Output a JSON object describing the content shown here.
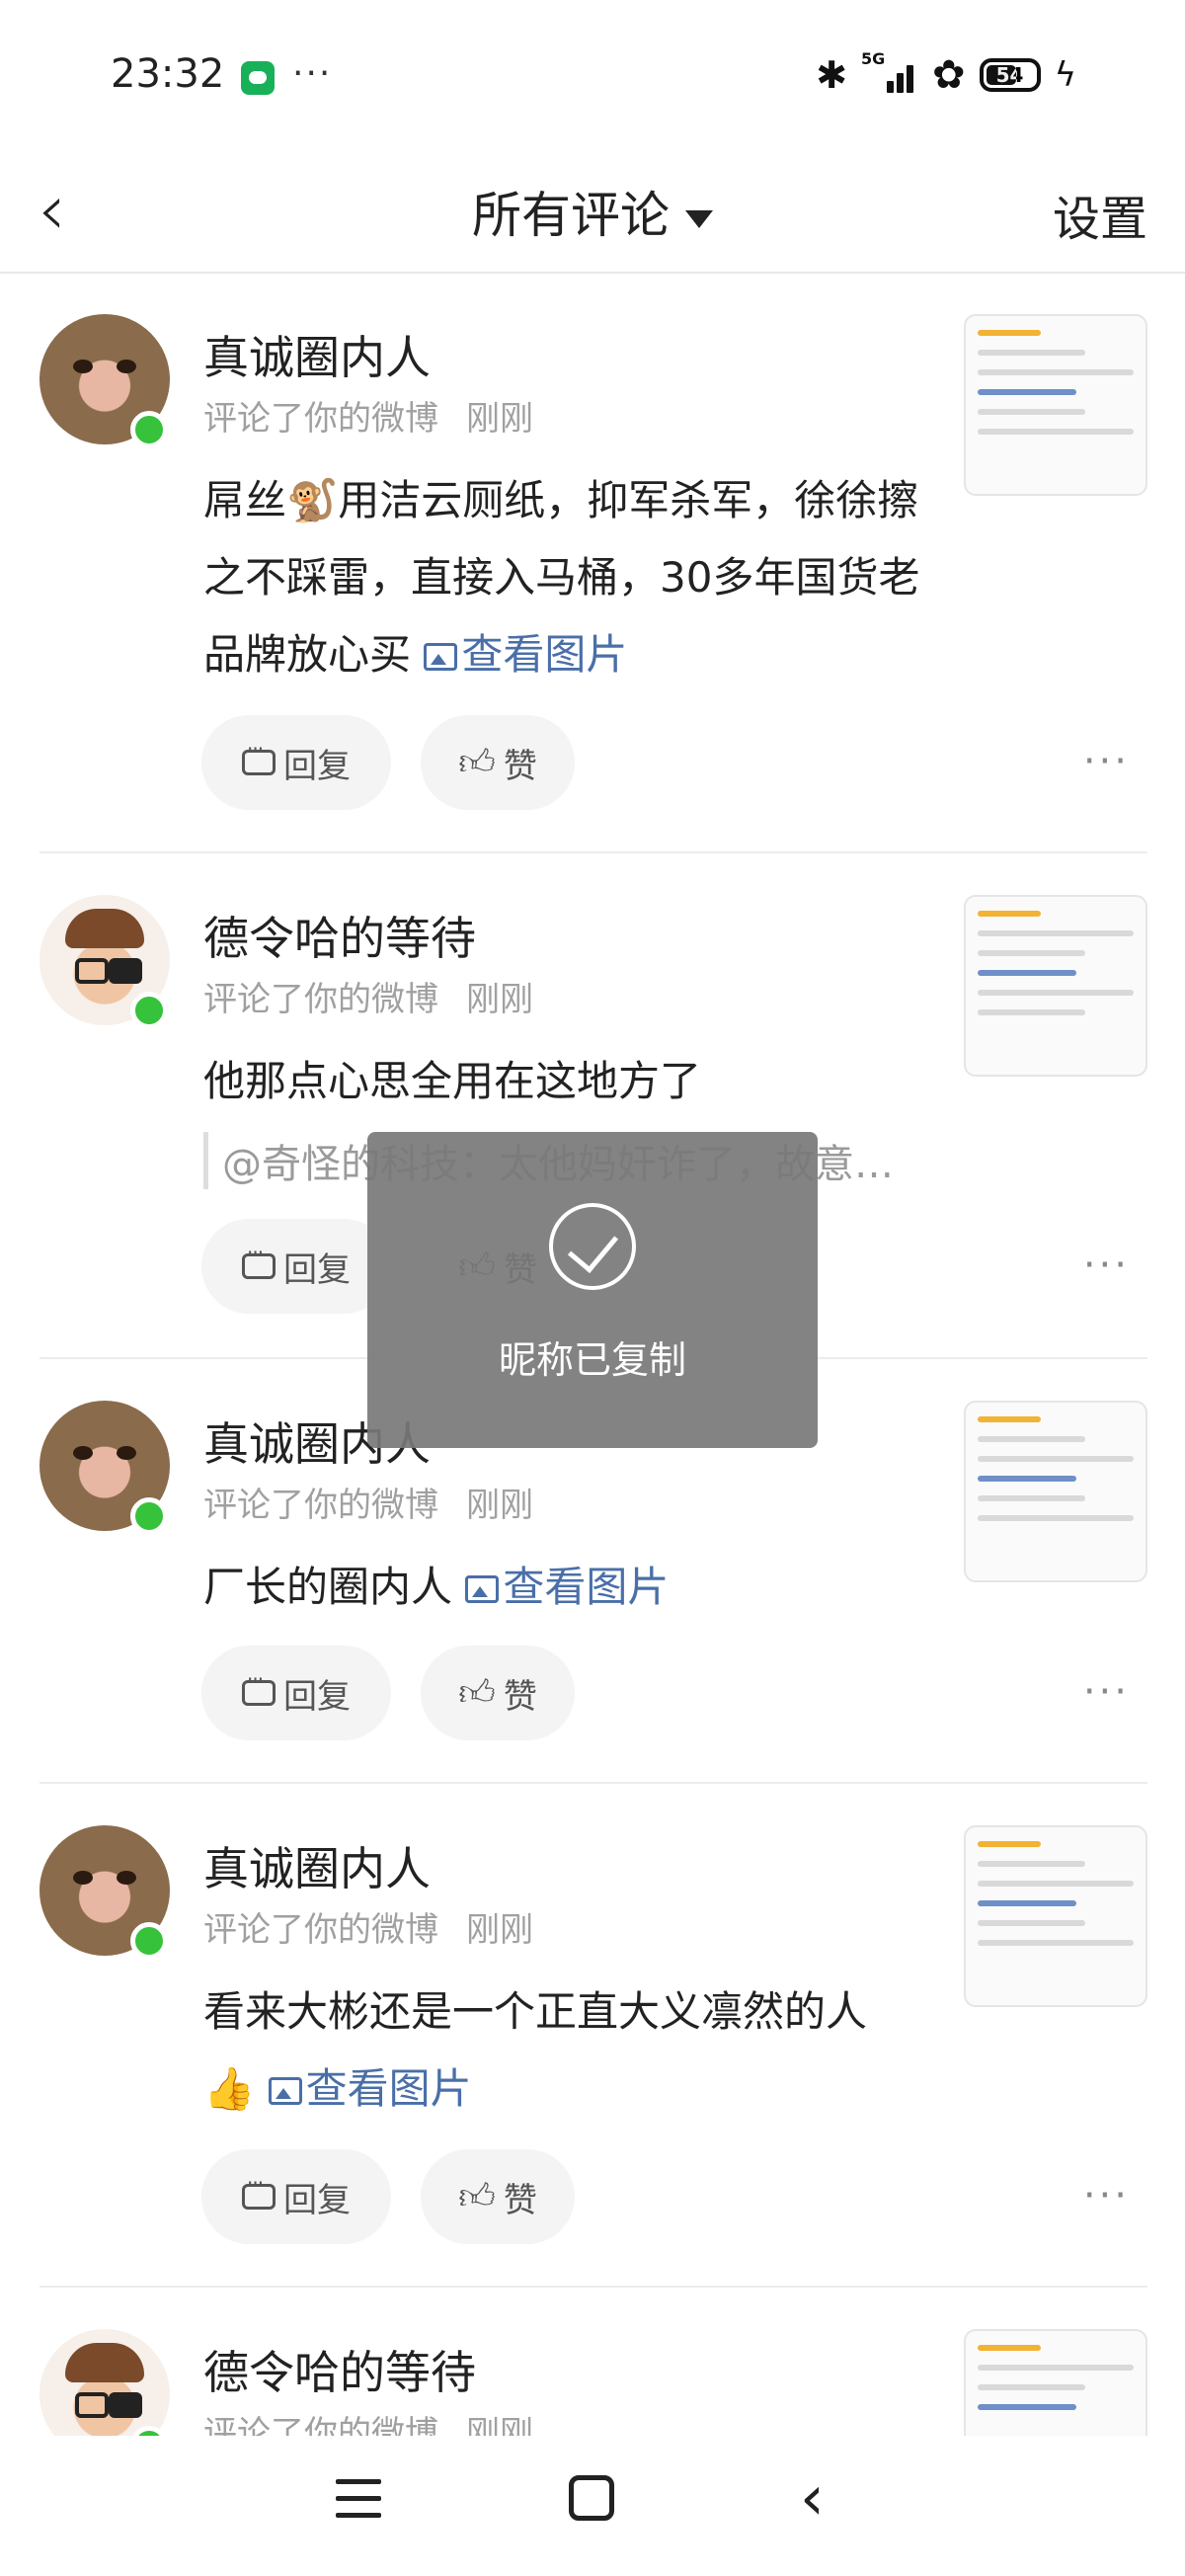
{
  "status_bar": {
    "time": "23:32",
    "dots": "···",
    "network": "5G",
    "battery": "54"
  },
  "header": {
    "back_icon": "chevron-left",
    "title": "所有评论",
    "settings": "设置"
  },
  "actions": {
    "reply": "回复",
    "like": "赞",
    "more": "···"
  },
  "comments": [
    {
      "name": "真诚圈内人",
      "action": "评论了你的微博",
      "time": "刚刚",
      "text": "屌丝🐒用洁云厕纸，抑军杀军，徐徐擦之不踩雷，直接入马桶，30多年国货老品牌放心买",
      "link": "查看图片"
    },
    {
      "name": "德令哈的等待",
      "action": "评论了你的微博",
      "time": "刚刚",
      "text": "他那点心思全用在这地方了",
      "quote": "@奇怪的科技：太他妈奸诈了，故意…"
    },
    {
      "name": "真诚圈内人",
      "action": "评论了你的微博",
      "time": "刚刚",
      "text": "厂长的圈内人",
      "link": "查看图片"
    },
    {
      "name": "真诚圈内人",
      "action": "评论了你的微博",
      "time": "刚刚",
      "text": "看来大彬还是一个正直大义凛然的人",
      "emoji": "👍",
      "link": "查看图片"
    },
    {
      "name": "德令哈的等待",
      "action": "评论了你的微博",
      "time": "刚刚"
    }
  ],
  "toast": {
    "message": "昵称已复制"
  },
  "colors": {
    "online": "#36c23b",
    "link": "#4a6fa8"
  }
}
